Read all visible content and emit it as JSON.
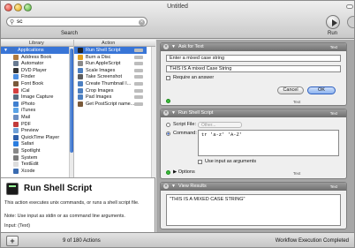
{
  "window": {
    "title": "Untitled"
  },
  "toolbar": {
    "search_value": "sc",
    "search_label": "Search",
    "run_label": "Run"
  },
  "library": {
    "header_library": "Library",
    "header_action": "Action",
    "categories": [
      {
        "label": "Applications",
        "icon": "applications-folder-icon",
        "color": "#3d73c9",
        "selected": true
      },
      {
        "label": "Address Book",
        "icon": "address-book-icon",
        "color": "#b07a3f"
      },
      {
        "label": "Automator",
        "icon": "automator-robot-icon",
        "color": "#6a7b92"
      },
      {
        "label": "DVD Player",
        "icon": "dvd-player-icon",
        "color": "#333333"
      },
      {
        "label": "Finder",
        "icon": "finder-icon",
        "color": "#4d8fe0"
      },
      {
        "label": "Font Book",
        "icon": "font-book-icon",
        "color": "#7a5a3a"
      },
      {
        "label": "iCal",
        "icon": "ical-icon",
        "color": "#d43f3f"
      },
      {
        "label": "Image Capture",
        "icon": "image-capture-icon",
        "color": "#5a6b80"
      },
      {
        "label": "iPhoto",
        "icon": "iphoto-icon",
        "color": "#3f7fd0"
      },
      {
        "label": "iTunes",
        "icon": "itunes-icon",
        "color": "#5aa3e6"
      },
      {
        "label": "Mail",
        "icon": "mail-icon",
        "color": "#6a8cc0"
      },
      {
        "label": "PDF",
        "icon": "pdf-icon",
        "color": "#c23b3b"
      },
      {
        "label": "Preview",
        "icon": "preview-icon",
        "color": "#6fa0d6"
      },
      {
        "label": "QuickTime Player",
        "icon": "quicktime-icon",
        "color": "#2f5fa8"
      },
      {
        "label": "Safari",
        "icon": "safari-icon",
        "color": "#2a7de0"
      },
      {
        "label": "Spotlight",
        "icon": "spotlight-icon",
        "color": "#888888"
      },
      {
        "label": "System",
        "icon": "system-icon",
        "color": "#7b7b7b"
      },
      {
        "label": "TextEdit",
        "icon": "textedit-icon",
        "color": "#dddddd"
      },
      {
        "label": "Xcode",
        "icon": "xcode-icon",
        "color": "#3a6bb0"
      }
    ],
    "actions": [
      {
        "label": "Run Shell Script",
        "icon": "terminal-icon",
        "color": "#222222",
        "selected": true
      },
      {
        "label": "Burn a Disc",
        "icon": "burn-disc-icon",
        "color": "#e0a020"
      },
      {
        "label": "Run AppleScript",
        "icon": "applescript-icon",
        "color": "#8a8a8a"
      },
      {
        "label": "Scale Images",
        "icon": "scale-images-icon",
        "color": "#4c7fc0"
      },
      {
        "label": "Take Screenshot",
        "icon": "camera-icon",
        "color": "#5c5c5c"
      },
      {
        "label": "Create Thumbnail I...",
        "icon": "thumbnail-icon",
        "color": "#4c7fc0"
      },
      {
        "label": "Crop Images",
        "icon": "crop-images-icon",
        "color": "#4c7fc0"
      },
      {
        "label": "Pad Images",
        "icon": "pad-images-icon",
        "color": "#4c7fc0"
      },
      {
        "label": "Get PostScript name...",
        "icon": "postscript-icon",
        "color": "#7a5a3a"
      }
    ]
  },
  "description": {
    "title": "Run Shell Script",
    "body": "This action executes unix commands, or runs a shell script file.",
    "note": "Note: Use input as stdin or as command line arguments.",
    "input": "Input: (Text)"
  },
  "statusbar": {
    "count": "9 of 180 Actions",
    "status": "Workflow Execution Completed"
  },
  "workflow": {
    "ask": {
      "title": "Ask for Text",
      "type_label": "Text",
      "question": "Enter a mixed case string",
      "default_answer": "THIS IS A mixed Case String",
      "require_label": "Require an answer",
      "cancel_label": "Cancel",
      "ok_label": "OK",
      "footer_type": "Text"
    },
    "shell": {
      "title": "Run Shell Script",
      "type_label": "Text",
      "script_file_label": "Script File:",
      "script_file_value": "Other...",
      "command_label": "Command:",
      "command_value": "tr 'a-z' 'A-Z'",
      "use_input_label": "Use input as arguments",
      "options_label": "Options",
      "footer_type": "Text"
    },
    "results": {
      "title": "View Results",
      "type_label": "Text",
      "value": "\"THIS IS A MIXED CASE STRING\""
    }
  }
}
